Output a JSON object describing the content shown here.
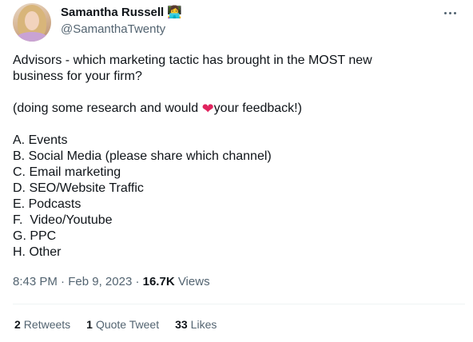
{
  "author": {
    "name": "Samantha Russell",
    "name_emoji": "👩‍💻",
    "handle": "@SamanthaTwenty"
  },
  "tweet": {
    "line1": "Advisors - which marketing tactic has brought in the MOST new",
    "line2": "business for your firm?",
    "line3_before": "(doing some research and would ",
    "heart": "❤",
    "line3_after": "your feedback!)",
    "options": [
      "A. Events",
      "B. Social Media (please share which channel)",
      "C. Email marketing",
      "D. SEO/Website Traffic",
      "E. Podcasts",
      "F.  Video/Youtube",
      "G. PPC",
      "H. Other"
    ]
  },
  "meta": {
    "time": "8:43 PM",
    "separator": " · ",
    "date": "Feb 9, 2023",
    "views_count": "16.7K",
    "views_label": " Views"
  },
  "stats": {
    "retweets_count": "2",
    "retweets_label": "Retweets",
    "quotes_count": "1",
    "quotes_label": "Quote Tweet",
    "likes_count": "33",
    "likes_label": "Likes"
  },
  "colors": {
    "text": "#0f1419",
    "secondary": "#536471",
    "divider": "#eff3f4",
    "heart": "#e0245e"
  }
}
